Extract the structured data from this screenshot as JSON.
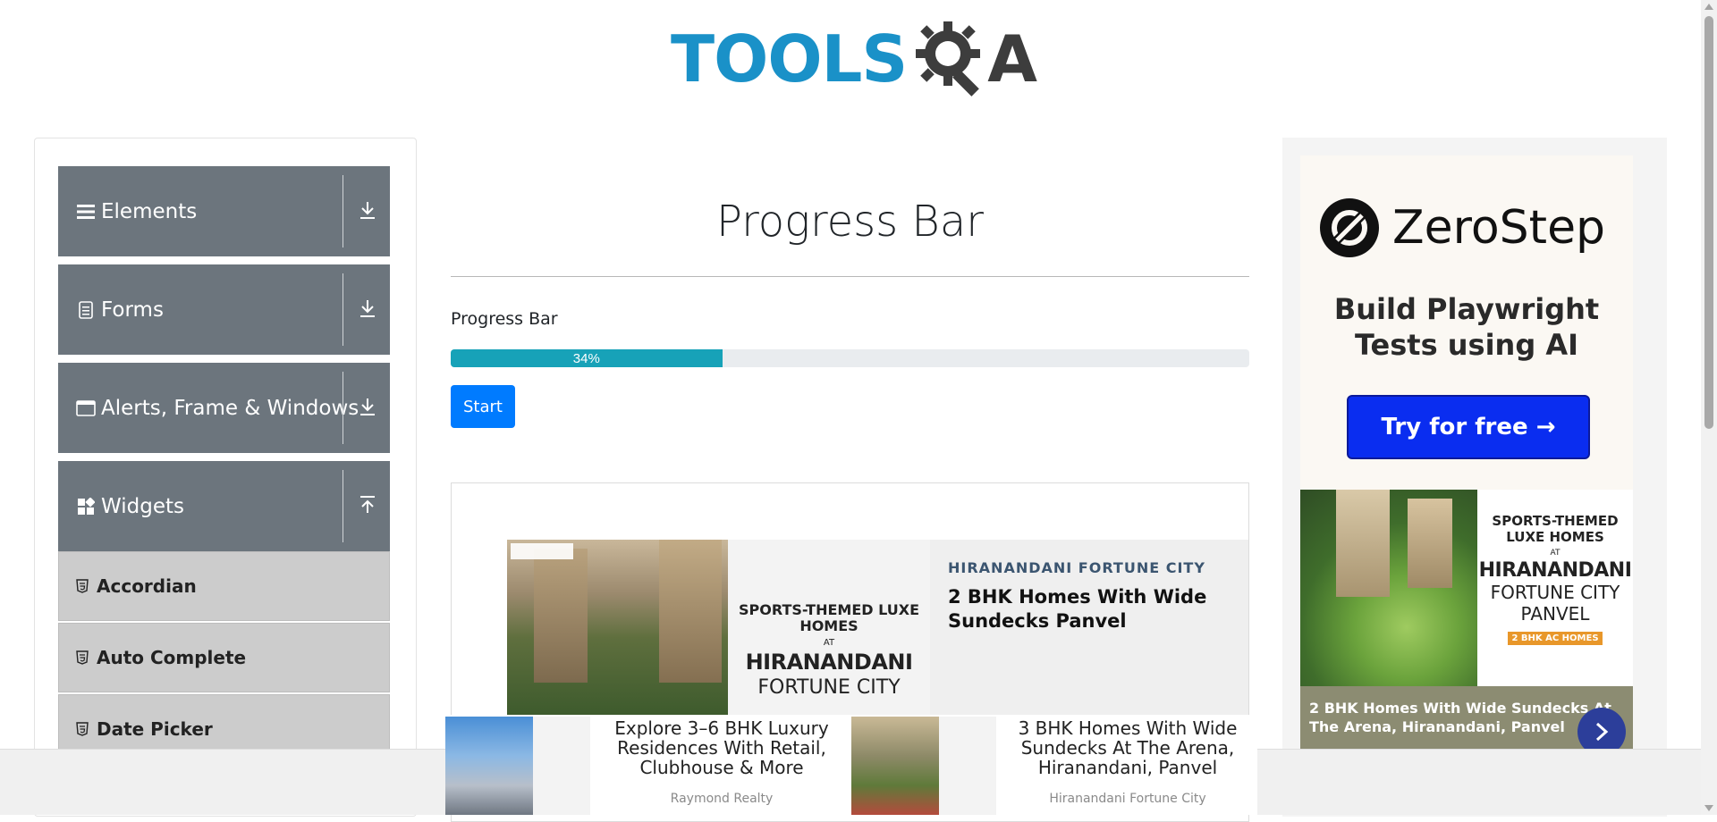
{
  "header": {
    "logo_tools": "TOOLS",
    "logo_a": "A"
  },
  "sidebar": {
    "groups": [
      {
        "label": "Elements",
        "icon": "hamburger-icon",
        "arrow": "download-arrow-icon"
      },
      {
        "label": "Forms",
        "icon": "document-icon",
        "arrow": "download-arrow-icon"
      },
      {
        "label": "Alerts, Frame & Windows",
        "icon": "window-icon",
        "arrow": "download-arrow-icon"
      },
      {
        "label": "Widgets",
        "icon": "widgets-icon",
        "arrow": "upload-arrow-icon"
      }
    ],
    "widget_items": [
      {
        "label": "Accordian"
      },
      {
        "label": "Auto Complete"
      },
      {
        "label": "Date Picker"
      }
    ]
  },
  "main": {
    "title": "Progress Bar",
    "progress_label": "Progress Bar",
    "progress_value": 34,
    "progress_text": "34%",
    "start_label": "Start"
  },
  "mid_ad": {
    "img_line1": "SPORTS-THEMED LUXE HOMES",
    "img_line2": "AT",
    "img_line3": "HIRANANDANI",
    "img_line4": "FORTUNE CITY",
    "brand": "HIRANANDANI FORTUNE CITY",
    "headline": "2 BHK Homes With Wide Sundecks Panvel"
  },
  "right_ad": {
    "zs_name": "ZeroStep",
    "zs_tagline": "Build Playwright Tests using AI",
    "zs_button": "Try for free →",
    "ad2_line1": "SPORTS-THEMED LUXE HOMES",
    "ad2_line2": "AT",
    "ad2_line3": "HIRANANDANI",
    "ad2_line4": "FORTUNE CITY PANVEL",
    "ad2_line5": "2 BHK AC HOMES",
    "ad2_caption": "2 BHK Homes With Wide Sundecks At The Arena, Hiranandani, Panvel"
  },
  "bottom_ad": {
    "items": [
      {
        "text": "Explore 3–6 BHK Luxury Residences With Retail, Clubhouse & More",
        "source": "Raymond Realty"
      },
      {
        "text": "3 BHK Homes With Wide Sundecks At The Arena, Hiranandani, Panvel",
        "source": "Hiranandani Fortune City"
      }
    ]
  },
  "colors": {
    "logo_blue": "#1a91c8",
    "sidebar_header": "#6c757d",
    "menu_item_bg": "#cccccc",
    "progress_fill": "#17a2b8",
    "primary": "#007bff",
    "zerostep_button": "#0a2df0"
  }
}
